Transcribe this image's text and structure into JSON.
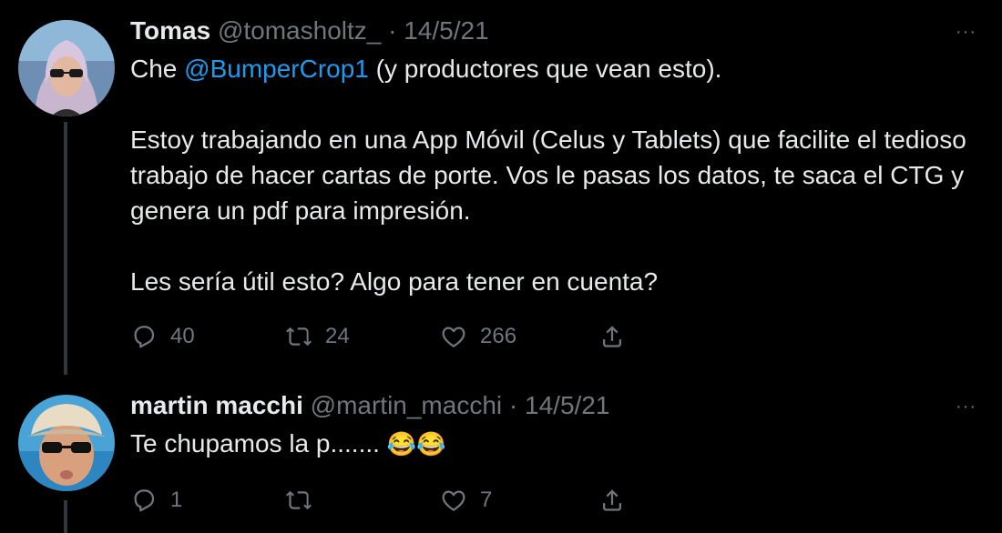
{
  "tweets": [
    {
      "name": "Tomas",
      "handle": "@tomasholtz_",
      "separator": "·",
      "date": "14/5/21",
      "more": "···",
      "body": {
        "line1_prefix": "Che ",
        "mention": "@BumperCrop1",
        "line1_suffix": " (y productores que vean esto).",
        "para2": "Estoy trabajando en una App Móvil (Celus y Tablets) que facilite el tedioso trabajo de hacer cartas de porte. Vos le pasas los datos, te saca el CTG y genera un pdf para impresión.",
        "para3": "Les sería útil esto? Algo para tener en cuenta?"
      },
      "replies": "40",
      "retweets": "24",
      "likes": "266"
    },
    {
      "name": "martin macchi",
      "handle": "@martin_macchi",
      "separator": "·",
      "date": "14/5/21",
      "more": "···",
      "body": {
        "text": "Te chupamos la p....... ",
        "emoji": "😂😂"
      },
      "replies": "1",
      "retweets": "",
      "likes": "7"
    }
  ],
  "colors": {
    "background": "#000000",
    "text": "#e7e9ea",
    "muted": "#71767b",
    "mention": "#1d9bf0",
    "thread_line": "#333639"
  },
  "icons": [
    "reply-icon",
    "retweet-icon",
    "like-icon",
    "share-icon",
    "more-icon"
  ]
}
